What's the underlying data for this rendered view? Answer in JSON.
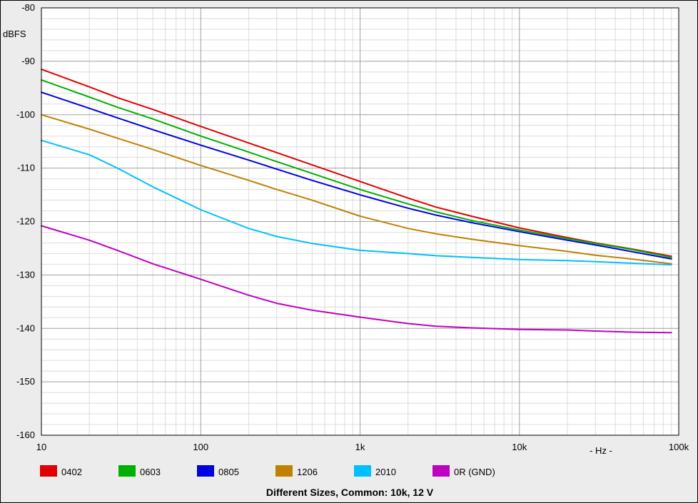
{
  "chart_data": {
    "type": "line",
    "title": "Different Sizes, Common: 10k, 12 V",
    "ylabel": "dBFS",
    "xlabel": "- Hz -",
    "xscale": "log",
    "xlim": [
      10,
      100000
    ],
    "ylim": [
      -160,
      -80
    ],
    "grid": true,
    "legend_position": "bottom",
    "x_ticks": [
      {
        "value": 10,
        "label": "10"
      },
      {
        "value": 100,
        "label": "100"
      },
      {
        "value": 1000,
        "label": "1k"
      },
      {
        "value": 10000,
        "label": "10k"
      },
      {
        "value": 100000,
        "label": "100k"
      }
    ],
    "y_ticks": [
      {
        "value": -80,
        "label": "-80"
      },
      {
        "value": -90,
        "label": "-90"
      },
      {
        "value": -100,
        "label": "-100"
      },
      {
        "value": -110,
        "label": "-110"
      },
      {
        "value": -120,
        "label": "-120"
      },
      {
        "value": -130,
        "label": "-130"
      },
      {
        "value": -140,
        "label": "-140"
      },
      {
        "value": -150,
        "label": "-150"
      },
      {
        "value": -160,
        "label": "-160"
      }
    ],
    "x": [
      10,
      20,
      30,
      50,
      100,
      200,
      300,
      500,
      1000,
      2000,
      3000,
      5000,
      10000,
      20000,
      30000,
      50000,
      90000
    ],
    "series": [
      {
        "name": "0402",
        "color": "#e00000",
        "values": [
          -91.5,
          -94.8,
          -96.8,
          -99.0,
          -102.2,
          -105.3,
          -107.1,
          -109.4,
          -112.5,
          -115.6,
          -117.3,
          -119.0,
          -121.2,
          -123.0,
          -124.0,
          -125.1,
          -126.5
        ]
      },
      {
        "name": "0603",
        "color": "#00b000",
        "values": [
          -93.5,
          -96.7,
          -98.6,
          -100.8,
          -104.0,
          -107.0,
          -108.8,
          -111.0,
          -114.0,
          -116.7,
          -118.2,
          -119.8,
          -121.6,
          -123.2,
          -124.1,
          -125.2,
          -126.7
        ]
      },
      {
        "name": "0805",
        "color": "#0000e0",
        "values": [
          -95.8,
          -98.8,
          -100.6,
          -102.8,
          -105.7,
          -108.5,
          -110.2,
          -112.3,
          -115.0,
          -117.5,
          -118.8,
          -120.2,
          -121.9,
          -123.5,
          -124.4,
          -125.6,
          -127.0
        ]
      },
      {
        "name": "1206",
        "color": "#c08000",
        "values": [
          -100.0,
          -102.7,
          -104.4,
          -106.5,
          -109.5,
          -112.3,
          -114.0,
          -116.0,
          -119.0,
          -121.3,
          -122.3,
          -123.3,
          -124.5,
          -125.6,
          -126.3,
          -127.0,
          -127.9
        ]
      },
      {
        "name": "2010",
        "color": "#00bfff",
        "values": [
          -104.8,
          -107.5,
          -110.0,
          -113.5,
          -117.8,
          -121.3,
          -122.8,
          -124.1,
          -125.4,
          -126.0,
          -126.4,
          -126.7,
          -127.1,
          -127.3,
          -127.5,
          -127.8,
          -128.1
        ]
      },
      {
        "name": "0R (GND)",
        "color": "#c000c0",
        "values": [
          -120.8,
          -123.5,
          -125.4,
          -127.9,
          -130.8,
          -133.8,
          -135.3,
          -136.6,
          -137.9,
          -139.1,
          -139.6,
          -139.9,
          -140.2,
          -140.3,
          -140.5,
          -140.7,
          -140.8
        ]
      }
    ]
  }
}
